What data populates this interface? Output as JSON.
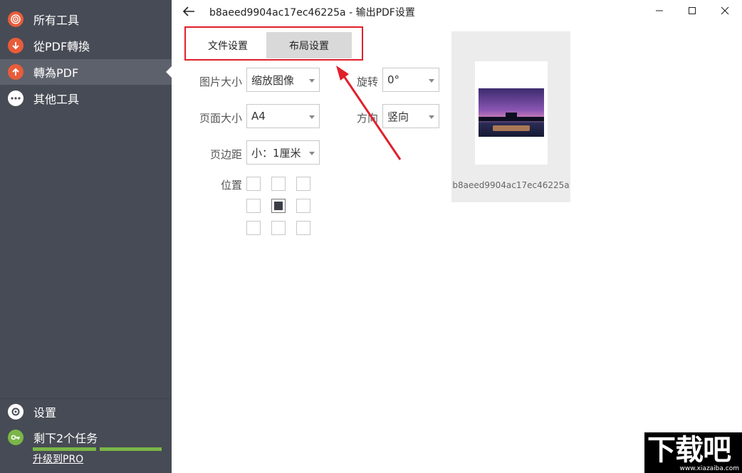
{
  "sidebar": {
    "items": [
      {
        "label": "所有工具",
        "icon": "spiral-icon",
        "color": "#e85c3a"
      },
      {
        "label": "從PDF轉換",
        "icon": "arrow-down-icon",
        "color": "#e85c3a"
      },
      {
        "label": "轉為PDF",
        "icon": "arrow-up-icon",
        "color": "#e85c3a"
      },
      {
        "label": "其他工具",
        "icon": "more-icon",
        "color": "#ffffff"
      }
    ],
    "settings_label": "设置",
    "tasks_label": "剩下2个任务",
    "upgrade_label": "升级到PRO",
    "progress_percent": 100
  },
  "header": {
    "title": "b8aeed9904ac17ec46225a - 输出PDF设置"
  },
  "tabs": [
    {
      "label": "文件设置",
      "selected": true
    },
    {
      "label": "布局设置",
      "selected": false
    }
  ],
  "form": {
    "image_size": {
      "label": "图片大小",
      "value": "缩放图像"
    },
    "rotation": {
      "label": "旋转",
      "value": "0°"
    },
    "page_size": {
      "label": "页面大小",
      "value": "A4"
    },
    "orientation": {
      "label": "方向",
      "value": "竖向"
    },
    "margin": {
      "label": "页边距",
      "value": "小：1厘米"
    },
    "position": {
      "label": "位置",
      "selected_index": 4
    }
  },
  "preview": {
    "filename": "b8aeed9904ac17ec46225a"
  },
  "watermark": {
    "text": "下载吧",
    "url": "www.xiazaiba.com"
  },
  "colors": {
    "sidebar_bg": "#474b55",
    "active_bg": "#5d616b",
    "accent": "#e85c3a",
    "highlight_red": "#e1202a",
    "progress_green": "#7ab648"
  }
}
